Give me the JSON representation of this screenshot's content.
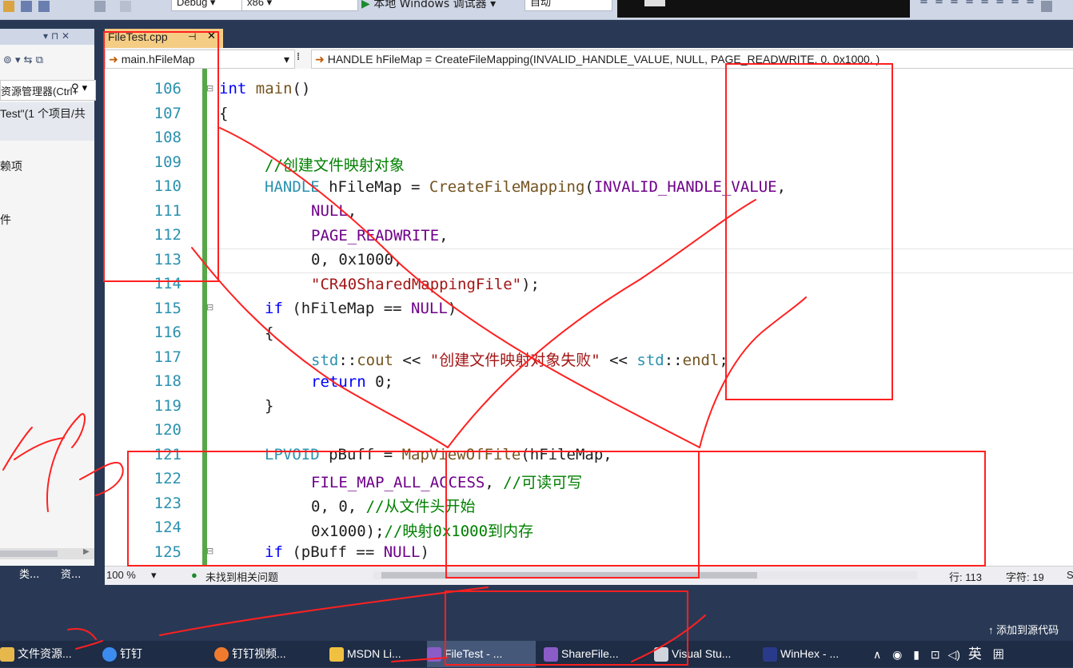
{
  "toolbar": {
    "config": "Debug",
    "platform": "x86",
    "debugger": "本地 Windows 调试器",
    "mode": "自动"
  },
  "solution_explorer": {
    "search": "资源管理器(Ctrl+",
    "solution": "Test\"(1 个项目/共",
    "item1": "赖项",
    "item2": "件",
    "tabs": [
      "类...",
      "资..."
    ]
  },
  "editor": {
    "tab_label": "FileTest.cpp",
    "nav_scope": "main.hFileMap",
    "nav_member": "HANDLE hFileMap = CreateFileMapping(INVALID_HANDLE_VALUE, NULL, PAGE_READWRITE, 0, 0x1000, )",
    "line_numbers": [
      "106",
      "107",
      "108",
      "109",
      "110",
      "111",
      "112",
      "113",
      "114",
      "115",
      "116",
      "117",
      "118",
      "119",
      "120",
      "121",
      "122",
      "123",
      "124",
      "125"
    ]
  },
  "status": {
    "zoom": "100 %",
    "issues": "未找到相关问题",
    "row": "行: 113",
    "col": "字符: 19",
    "extra": "S"
  },
  "add_source": "添加到源代码",
  "taskbar": {
    "items": [
      "文件资源...",
      "钉钉",
      "钉钉视频...",
      "MSDN Li...",
      "FileTest - ...",
      "ShareFile...",
      "Visual Stu...",
      "WinHex - ..."
    ],
    "ime": "英"
  },
  "colors": {
    "keyword": "#0000ff",
    "type": "#2b91af",
    "macro": "#6f008a",
    "string": "#a31515",
    "comment": "#008000",
    "annotation": "#ff2020"
  }
}
